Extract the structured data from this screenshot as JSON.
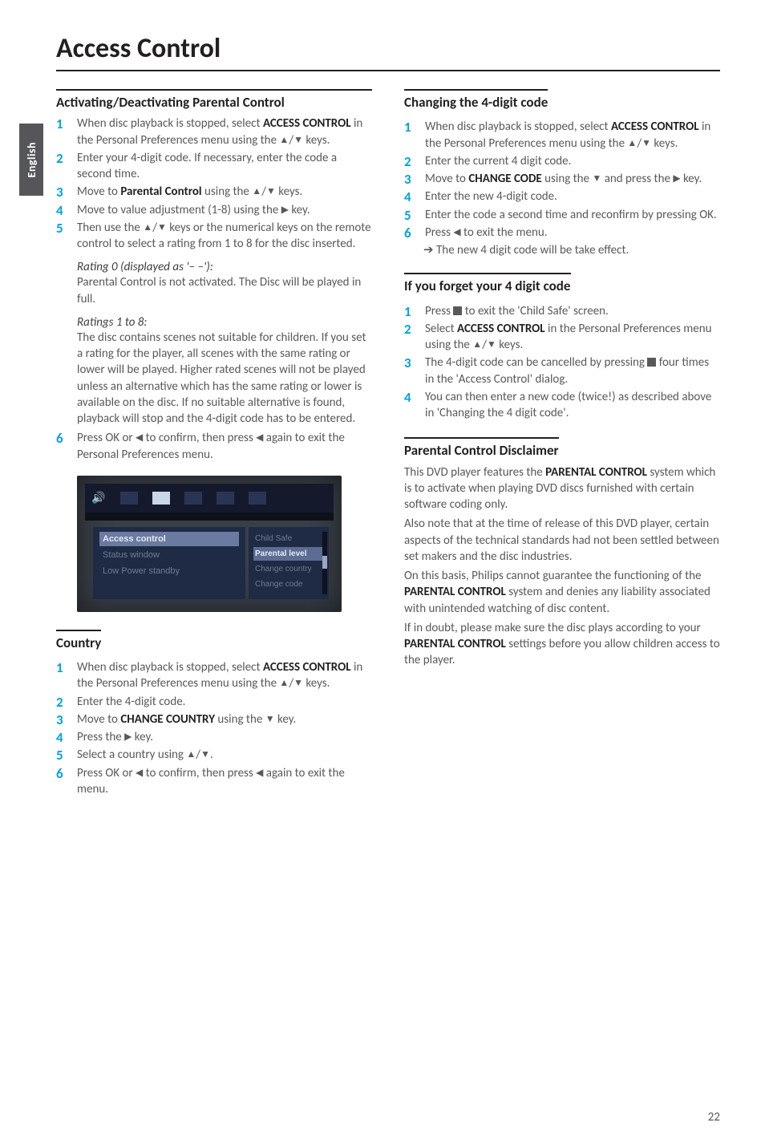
{
  "sidetab": "English",
  "page_title": "Access Control",
  "page_number": "22",
  "icons": {
    "up": "▲",
    "down": "▼",
    "left": "◀",
    "right": "▶"
  },
  "left": {
    "activating": {
      "heading": "Activating/Deactivating Parental Control",
      "s1a": "When disc playback is stopped, select ",
      "s1b": "ACCESS CONTROL",
      "s1c": " in the Personal Preferences menu using the ",
      "s1d": " keys.",
      "s2": "Enter your 4-digit code. If necessary, enter the code a second time.",
      "s3a": "Move to ",
      "s3b": "Parental Control",
      "s3c": " using the ",
      "s3d": " keys.",
      "s4a": "Move to value adjustment (1-8) using the ",
      "s4b": " key.",
      "s5a": "Then use the ",
      "s5b": " keys or the numerical keys on the remote control to select a rating from 1 to 8 for the disc inserted.",
      "r0_title": "Rating 0 (displayed as '– –'):",
      "r0_body": "Parental Control is not activated. The Disc will be played in full.",
      "r1_title": "Ratings 1 to 8:",
      "r1_body": "The disc contains scenes not suitable for children. If you set a rating for the player, all scenes with the same rating or lower will be played. Higher rated scenes will not be played unless an alternative which has the same rating or lower is available on the disc. If no suitable alternative is found, playback will stop and the 4-digit code has to be entered.",
      "s6a": "Press OK or ",
      "s6b": " to confirm, then press ",
      "s6c": " again to exit the Personal Preferences menu."
    },
    "screenshot": {
      "menu_sel": "Access control",
      "menu_dim1": "Status window",
      "menu_dim2": "Low Power standby",
      "r_dim1": "Child Safe",
      "r_sel": "Parental level",
      "r_dim2": "Change country",
      "r_dim3": "Change code"
    },
    "country": {
      "heading": "Country",
      "s1a": "When disc playback is stopped, select ",
      "s1b": "ACCESS CONTROL",
      "s1c": " in the Personal Preferences menu using the ",
      "s1d": " keys.",
      "s2": "Enter the 4-digit code.",
      "s3a": "Move to ",
      "s3b": "CHANGE COUNTRY",
      "s3c": " using the ",
      "s3d": " key.",
      "s4a": "Press the ",
      "s4b": " key.",
      "s5a": "Select a country using ",
      "s5b": ".",
      "s6a": "Press OK or ",
      "s6b": " to confirm, then press ",
      "s6c": " again to exit the menu."
    }
  },
  "right": {
    "changing": {
      "heading": "Changing the 4-digit code",
      "s1a": "When disc playback is stopped, select ",
      "s1b": "ACCESS CONTROL",
      "s1c": " in the Personal Preferences menu using the ",
      "s1d": " keys.",
      "s2": "Enter the current 4 digit code.",
      "s3a": "Move to ",
      "s3b": "CHANGE CODE",
      "s3c": " using the ",
      "s3d": " and press the ",
      "s3e": " key.",
      "s4": "Enter the new 4-digit code.",
      "s5": "Enter the code a second time and reconfirm by pressing OK.",
      "s6a": "Press ",
      "s6b": " to exit the menu.",
      "s6_arrow": "The new 4 digit code will be take effect."
    },
    "forget": {
      "heading": "If you forget your 4 digit code",
      "s1a": "Press ",
      "s1b": " to exit the 'Child Safe' screen.",
      "s2a": "Select ",
      "s2b": "ACCESS CONTROL",
      "s2c": " in the Personal Preferences menu  using the ",
      "s2d": " keys.",
      "s3a": "The 4-digit code can be cancelled by pressing ",
      "s3b": " four times in the 'Access Control' dialog.",
      "s4": "You can then enter a new code (twice!) as described above in 'Changing the 4 digit code'."
    },
    "disclaimer": {
      "heading": "Parental Control Disclaimer",
      "p1a": "This DVD player features the ",
      "p1b": "PARENTAL CONTROL",
      "p1c": " system which is to activate when playing DVD discs furnished with certain software coding only.",
      "p2": "Also note that at the time of release of this DVD player, certain aspects of the technical standards had not been settled between set makers and the disc industries.",
      "p3a": "On this basis, Philips cannot guarantee the functioning of the ",
      "p3b": "PARENTAL CONTROL",
      "p3c": " system and denies any liability associated with unintended watching of disc content.",
      "p4a": "If in doubt, please make sure the disc plays according to your ",
      "p4b": "PARENTAL CONTROL",
      "p4c": " settings before you allow children access to the player."
    }
  }
}
